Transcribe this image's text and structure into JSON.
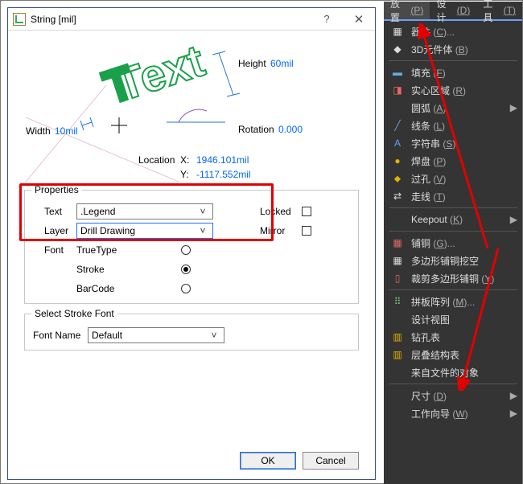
{
  "dialog": {
    "title": "String  [mil]",
    "width_label": "Width",
    "width_value": "10mil",
    "height_label": "Height",
    "height_value": "60mil",
    "rotation_label": "Rotation",
    "rotation_value": "0.000",
    "location_label": "Location",
    "x_label": "X:",
    "x_value": "1946.101mil",
    "y_label": "Y:",
    "y_value": "-1117.552mil",
    "sample_text": "Text",
    "properties": {
      "legend": "Properties",
      "text_label": "Text",
      "text_value": ".Legend",
      "layer_label": "Layer",
      "layer_value": "Drill Drawing",
      "locked_label": "Locked",
      "mirror_label": "Mirror",
      "font_label": "Font",
      "font_options": [
        "TrueType",
        "Stroke",
        "BarCode"
      ],
      "font_selected": "Stroke"
    },
    "stroke": {
      "legend": "Select Stroke Font",
      "fontname_label": "Font Name",
      "fontname_value": "Default"
    },
    "ok": "OK",
    "cancel": "Cancel"
  },
  "menu": {
    "tabs": [
      {
        "label": "放置",
        "key": "P",
        "active": true
      },
      {
        "label": "设计",
        "key": "D"
      },
      {
        "label": "工具",
        "key": "T"
      }
    ],
    "items": [
      {
        "icon": "▦",
        "color": "#ddd",
        "label": "器件",
        "key": "(C)...",
        "sep": false
      },
      {
        "icon": "◆",
        "color": "#ddd",
        "label": "3D元件体",
        "key": "(B)",
        "sep": false
      },
      {
        "sep": true
      },
      {
        "icon": "▬",
        "color": "#6ad",
        "label": "填充",
        "key": "(F)",
        "sep": false
      },
      {
        "icon": "◨",
        "color": "#e66",
        "label": "实心区域",
        "key": "(R)",
        "sep": false
      },
      {
        "icon": "",
        "color": "",
        "label": "圆弧",
        "key": "(A)",
        "arrow": true,
        "sep": false
      },
      {
        "icon": "╱",
        "color": "#6ad",
        "label": "线条",
        "key": "(L)",
        "sep": false
      },
      {
        "icon": "A",
        "color": "#5aa2f0",
        "label": "字符串",
        "key": "(S)",
        "sep": false
      },
      {
        "icon": "●",
        "color": "#e3b100",
        "label": "焊盘",
        "key": "(P)",
        "sep": false
      },
      {
        "icon": "⬥",
        "color": "#e3b100",
        "label": "过孔",
        "key": "(V)",
        "sep": false
      },
      {
        "icon": "⇄",
        "color": "#ddd",
        "label": "走线",
        "key": "(T)",
        "sep": false
      },
      {
        "sep": true
      },
      {
        "icon": "",
        "color": "",
        "label": "Keepout",
        "key": "(K)",
        "arrow": true,
        "sep": false
      },
      {
        "sep": true
      },
      {
        "icon": "▦",
        "color": "#d66",
        "label": "铺铜",
        "key": "(G)...",
        "sep": false
      },
      {
        "icon": "▦",
        "color": "#ddd",
        "label": "多边形铺铜挖空",
        "key": "",
        "sep": false
      },
      {
        "icon": "▯",
        "color": "#d66",
        "label": "裁剪多边形铺铜",
        "key": "(Y)",
        "sep": false
      },
      {
        "sep": true
      },
      {
        "icon": "⠿",
        "color": "#7c7",
        "label": "拼板阵列",
        "key": "(M)...",
        "sep": false
      },
      {
        "icon": "",
        "color": "",
        "label": "设计视图",
        "key": "",
        "sep": false
      },
      {
        "icon": "▥",
        "color": "#e3b100",
        "label": "钻孔表",
        "key": "",
        "sep": false
      },
      {
        "icon": "▥",
        "color": "#e3b100",
        "label": "层叠结构表",
        "key": "",
        "sep": false
      },
      {
        "icon": "",
        "color": "",
        "label": "来自文件的对象",
        "key": "",
        "sep": false
      },
      {
        "sep": true
      },
      {
        "icon": "",
        "color": "",
        "label": "尺寸",
        "key": "(D)",
        "arrow": true,
        "sep": false
      },
      {
        "icon": "",
        "color": "",
        "label": "工作向导",
        "key": "(W)",
        "arrow": true,
        "sep": false
      }
    ]
  }
}
